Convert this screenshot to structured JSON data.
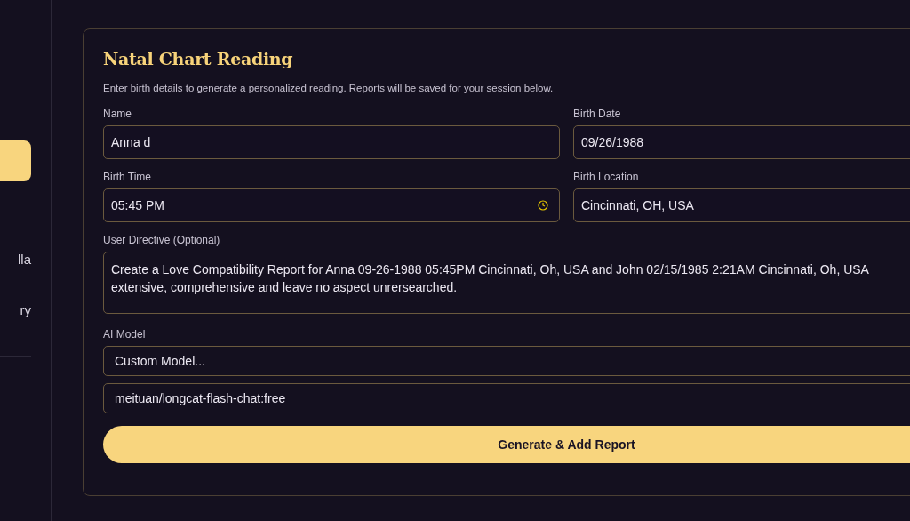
{
  "sidebar": {
    "items": [
      {
        "selected": true
      },
      {
        "label": "lla",
        "selected": false
      },
      {
        "label": "ry",
        "selected": false
      }
    ]
  },
  "form": {
    "title": "Natal Chart Reading",
    "subtitle": "Enter birth details to generate a personalized reading. Reports will be saved for your session below.",
    "fields": [
      {
        "label": "Name",
        "value": "Anna d",
        "kind": "text"
      },
      {
        "label": "Birth Date",
        "value": "09/26/1988",
        "kind": "text"
      },
      {
        "label": "Birth Time",
        "value": "05:45 PM",
        "kind": "time"
      },
      {
        "label": "Birth Location",
        "value": "Cincinnati, OH, USA",
        "kind": "text"
      }
    ],
    "directive": {
      "label": "User Directive (Optional)",
      "lines": [
        "Create a Love Compatibility Report for Anna 09-26-1988 05:45PM Cincinnati, Oh, USA and John 02/15/1985 2:21AM Cincinnati, Oh, USA",
        "extensive, comprehensive and leave no aspect unrersearched."
      ]
    },
    "model": {
      "label": "AI Model",
      "selected": "Custom Model...",
      "custom": "meituan/longcat-flash-chat:free"
    },
    "submit": "Generate & Add Report"
  }
}
